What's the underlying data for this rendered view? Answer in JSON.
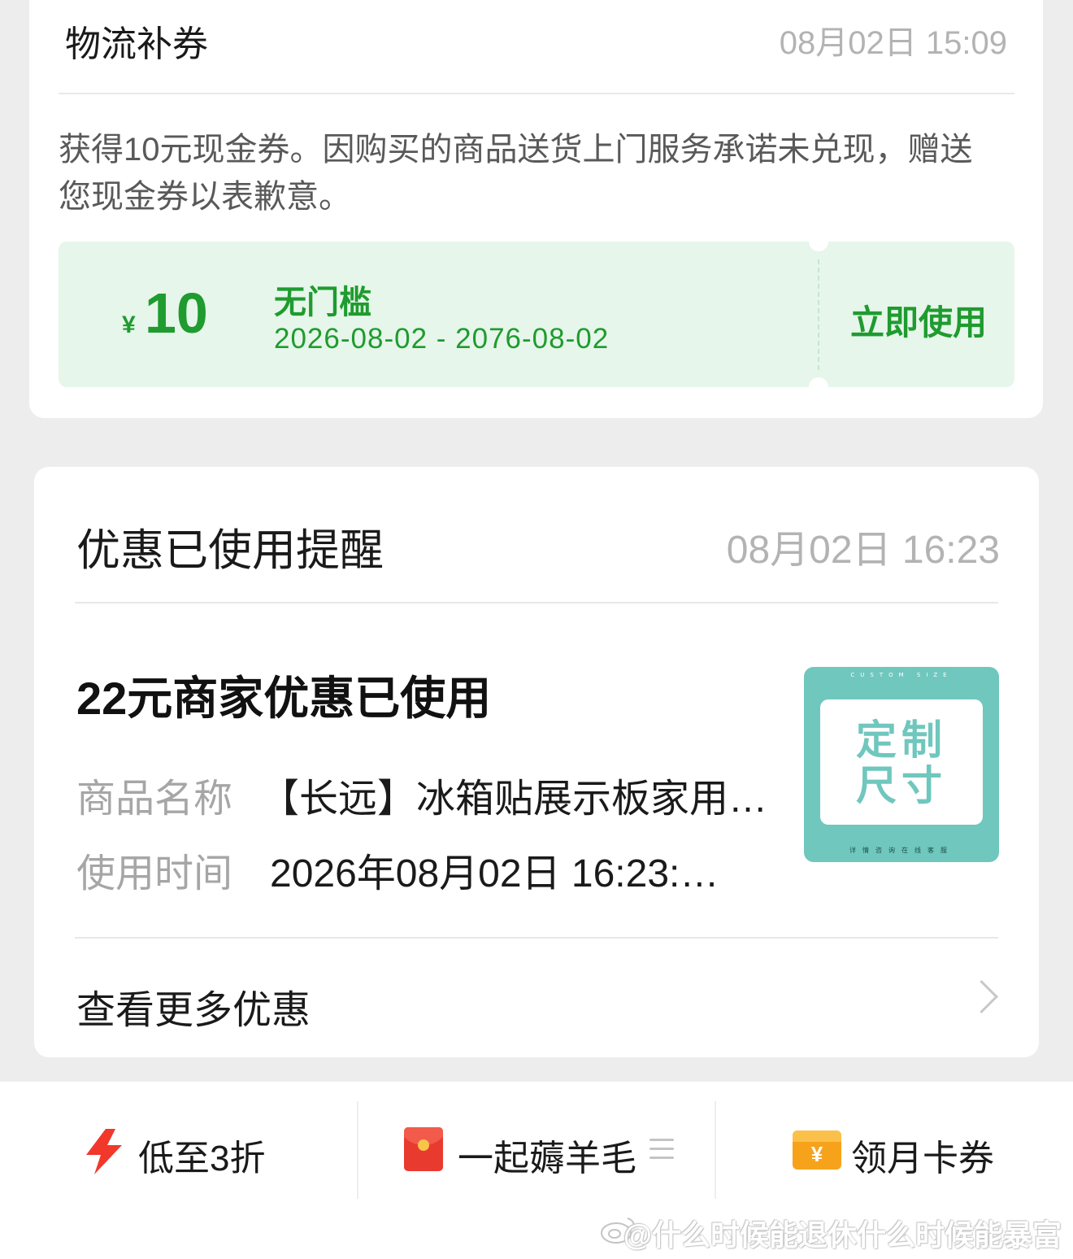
{
  "logistics_card": {
    "title": "物流补券",
    "time": "08月02日 15:09",
    "description": "获得10元现金券。因购买的商品送货上门服务承诺未兑现，赠送您现金券以表歉意。",
    "coupon": {
      "currency": "¥",
      "amount": "10",
      "title": "无门槛",
      "validity": "2026-08-02 - 2076-08-02",
      "use_label": "立即使用"
    },
    "colors": {
      "accent": "#1f9b2f",
      "coupon_bg": "#e6f6ea"
    }
  },
  "discount_card": {
    "title": "优惠已使用提醒",
    "time": "08月02日 16:23",
    "headline": "22元商家优惠已使用",
    "rows": [
      {
        "label": "商品名称",
        "value": "【长远】冰箱贴展示板家用…"
      },
      {
        "label": "使用时间",
        "value": "2026年08月02日 16:23:…"
      }
    ],
    "product_image": {
      "top_text": "CUSTOM SIZE",
      "main_text_line1": "定制",
      "main_text_line2": "尺寸",
      "bottom_text": "详情咨询在线客服",
      "color": "#6fc7bd"
    },
    "more_label": "查看更多优惠"
  },
  "bottom_bar": {
    "items": [
      {
        "label": "低至3折",
        "icon": "lightning-icon"
      },
      {
        "label": "一起薅羊毛",
        "icon": "red-packet-icon"
      },
      {
        "label": "领月卡券",
        "icon": "card-coupon-icon"
      }
    ],
    "colors": {
      "lightning": "#f2372b",
      "card": "#f7a21b"
    }
  },
  "watermark": "@什么时候能退休什么时候能暴富"
}
